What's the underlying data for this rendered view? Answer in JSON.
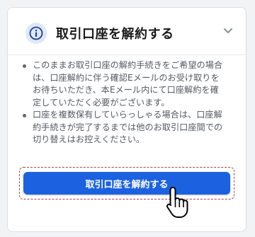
{
  "panel": {
    "title": "取引口座を解約する",
    "icons": {
      "info": "info-icon",
      "collapse": "chevron-down-icon",
      "cursor": "hand-pointer-icon"
    }
  },
  "notes": [
    "このままお取引口座の解約手続きをご希望の場合は、口座解約に伴う確認Eメールのお受け取りをお待ちいただき、本Eメール内にて口座解約を確定していただく必要がございます。",
    "口座を複数保有していらっしゃる場合は、口座解約手続きが完了するまでは他のお取引口座間での切り替えはお控えください。"
  ],
  "action": {
    "label": "取引口座を解約する"
  },
  "colors": {
    "accent": "#1c62e0",
    "focus_ring": "#a2424d",
    "icon_bg": "#dfe8fa"
  }
}
